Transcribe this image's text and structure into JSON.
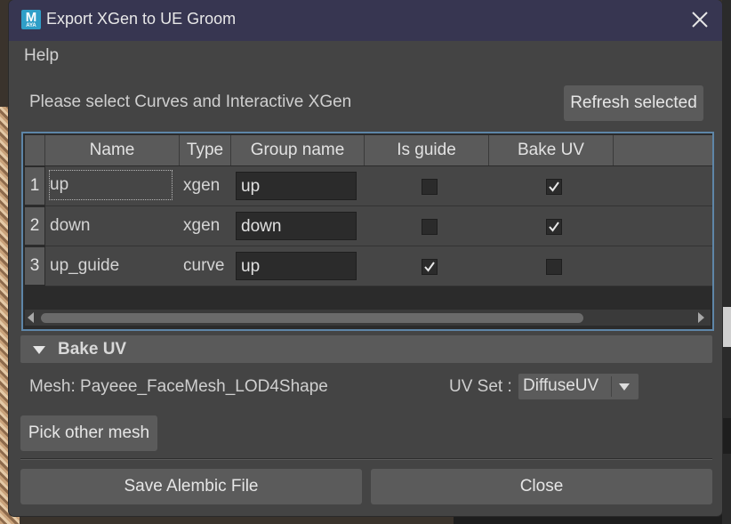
{
  "window": {
    "title": "Export XGen to UE Groom",
    "icon_letter": "M",
    "icon_sub": "AYA"
  },
  "menu": {
    "help": "Help"
  },
  "prompt": "Please select Curves and Interactive XGen",
  "refresh_button": "Refresh selected",
  "table": {
    "headers": [
      "Name",
      "Type",
      "Group name",
      "Is guide",
      "Bake UV"
    ],
    "rows": [
      {
        "index": "1",
        "name": "up",
        "type": "xgen",
        "group": "up",
        "is_guide": false,
        "bake_uv": true
      },
      {
        "index": "2",
        "name": "down",
        "type": "xgen",
        "group": "down",
        "is_guide": false,
        "bake_uv": true
      },
      {
        "index": "3",
        "name": "up_guide",
        "type": "curve",
        "group": "up",
        "is_guide": true,
        "bake_uv": false
      }
    ]
  },
  "bake_uv_section": {
    "title": "Bake UV",
    "mesh_label": "Mesh: Payeee_FaceMesh_LOD4Shape",
    "uv_set_label": "UV Set :",
    "uv_set_value": "DiffuseUV"
  },
  "pick_mesh_button": "Pick other mesh",
  "save_button": "Save Alembic File",
  "close_button": "Close",
  "colors": {
    "titlebar": "#373651",
    "dialog_bg": "#444444",
    "selection_border": "#5e86a8"
  }
}
